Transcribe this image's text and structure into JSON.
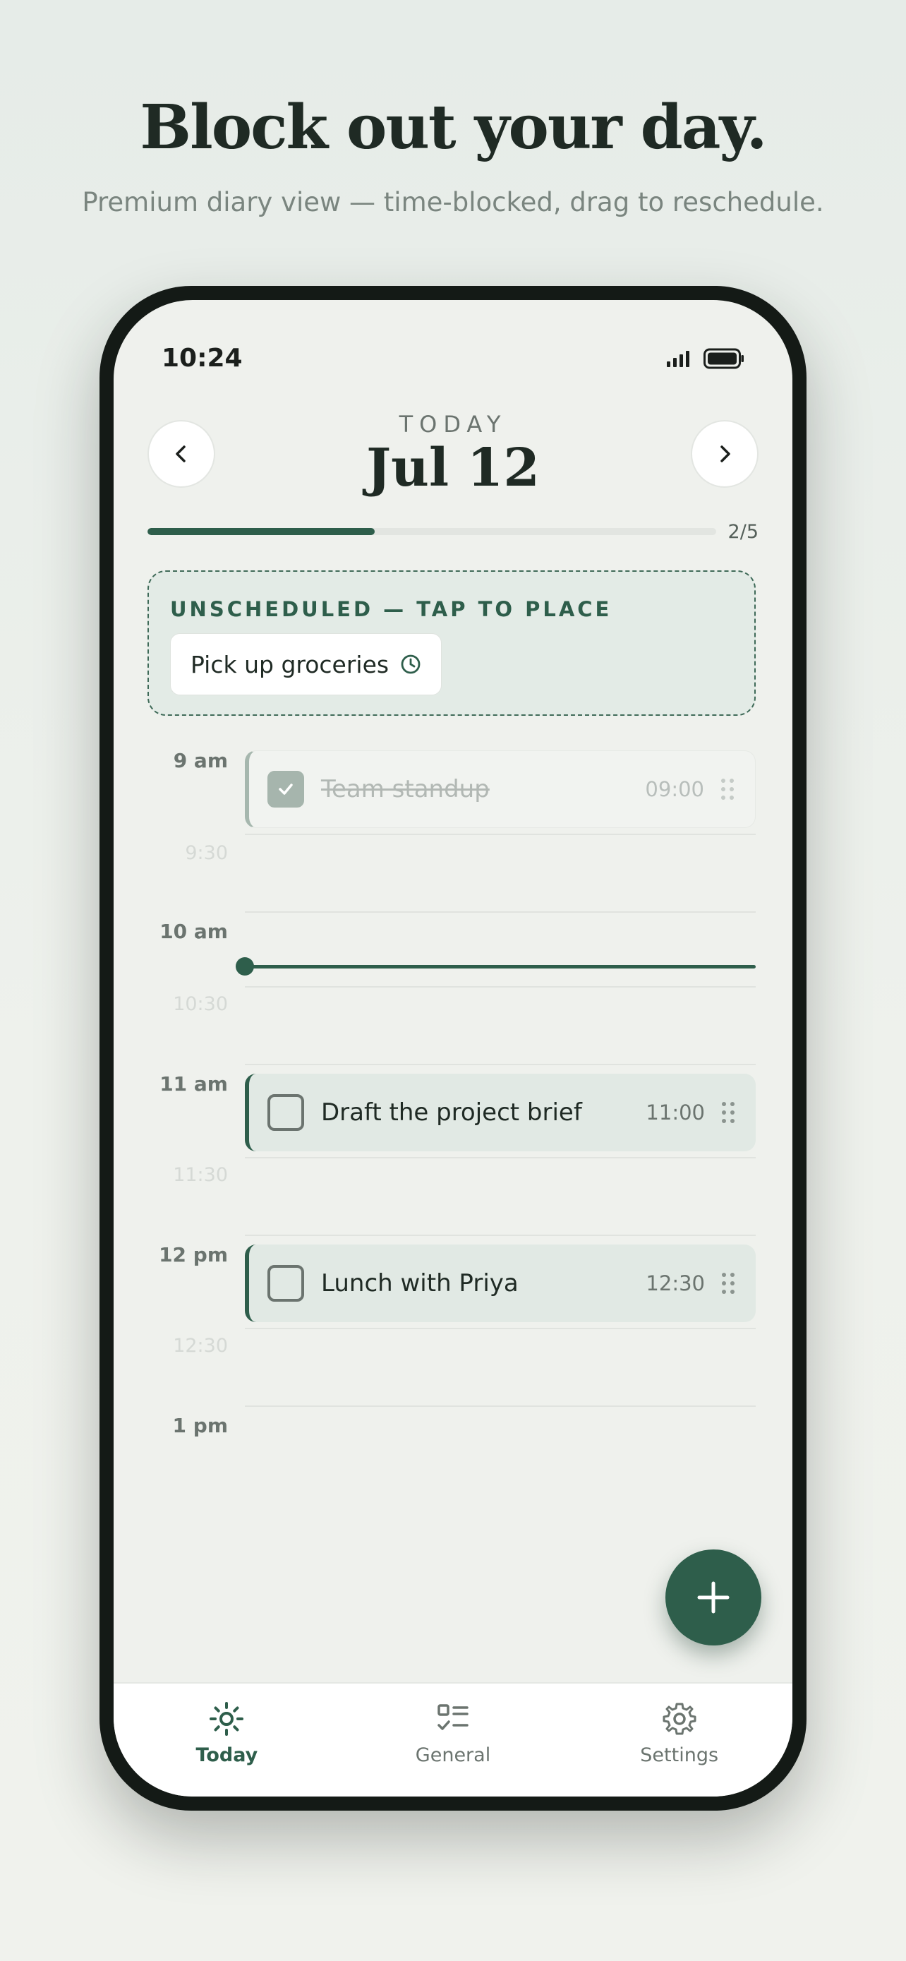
{
  "hero": {
    "title": "Block out your day.",
    "subtitle": "Premium diary view — time-blocked, drag to reschedule."
  },
  "status_bar": {
    "time": "10:24"
  },
  "header": {
    "eyebrow": "TODAY",
    "date": "Jul 12",
    "prev_icon": "chevron-left-icon",
    "next_icon": "chevron-right-icon"
  },
  "progress": {
    "completed": 2,
    "total": 5,
    "fraction": 0.4,
    "text": "2/5"
  },
  "unscheduled": {
    "label": "UNSCHEDULED — TAP TO PLACE",
    "items": [
      {
        "title": "Pick up groceries",
        "icon": "clock-icon"
      }
    ]
  },
  "timeline": {
    "hours": [
      "9 am",
      "10 am",
      "11 am",
      "12 pm",
      "1 pm"
    ],
    "half_hours": [
      "9:30",
      "10:30",
      "11:30",
      "12:30"
    ],
    "tasks": [
      {
        "title": "Team standup",
        "time": "09:00",
        "done": true
      },
      {
        "title": "Draft the project brief",
        "time": "11:00",
        "done": false
      },
      {
        "title": "Lunch with Priya",
        "time": "12:30",
        "done": false
      }
    ]
  },
  "fab": {
    "icon": "plus-icon"
  },
  "tabs": [
    {
      "label": "Today",
      "icon": "sun-icon",
      "active": true
    },
    {
      "label": "General",
      "icon": "checklist-icon",
      "active": false
    },
    {
      "label": "Settings",
      "icon": "gear-icon",
      "active": false
    }
  ],
  "colors": {
    "accent": "#2e5e4b",
    "background": "#eff1ed",
    "text": "#1f2a24"
  }
}
